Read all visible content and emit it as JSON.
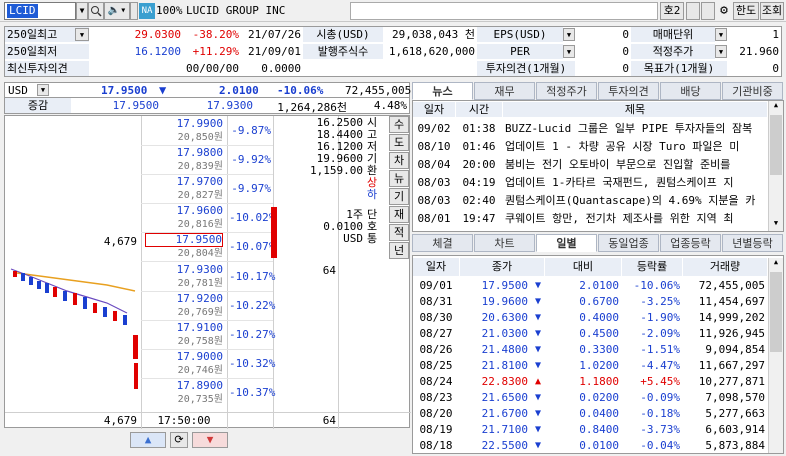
{
  "top": {
    "ticker": "LCID",
    "exchange": "NA",
    "pct": "100%",
    "name": "LUCID GROUP INC",
    "slot": "호2",
    "btn_lock": "한도",
    "btn_query": "조회"
  },
  "info_rows": [
    [
      "250일최고",
      "29.0300",
      "-38.20%",
      "21/07/26",
      "시총(USD)",
      "29,038,043 천",
      "EPS(USD)",
      "0",
      "매매단위",
      "1"
    ],
    [
      "250일최저",
      "16.1200",
      "+11.29%",
      "21/09/01",
      "발행주식수",
      "1,618,620,000",
      "PER",
      "0",
      "적정주가",
      "21.960"
    ],
    [
      "최신투자의견",
      "00/00/00",
      "0.0000",
      "",
      "",
      "",
      "투자의견(1개월)",
      "0",
      "목표가(1개월)",
      "0"
    ]
  ],
  "price": {
    "ccy": "USD",
    "last": "17.9500",
    "arrow": "▼",
    "chg": "2.0100",
    "chg_pct": "-10.06%",
    "volume": "72,455,005",
    "label": "증감",
    "bid": "17.9500",
    "ask": "17.9300",
    "vol2": "1,264,286천",
    "ratio": "4.48%"
  },
  "ladder": [
    {
      "p": "17.9900",
      "q": "20,850원",
      "pct": "-9.87%"
    },
    {
      "p": "17.9800",
      "q": "20,839원",
      "pct": "-9.92%"
    },
    {
      "p": "17.9700",
      "q": "20,827원",
      "pct": "-9.97%"
    },
    {
      "p": "17.9600",
      "q": "20,816원",
      "pct": "-10.02%"
    },
    {
      "p": "17.9500",
      "q": "20,804원",
      "pct": "-10.07%",
      "left": "4,679"
    },
    {
      "p": "17.9300",
      "q": "20,781원",
      "pct": "-10.17%",
      "right": "64"
    },
    {
      "p": "17.9200",
      "q": "20,769원",
      "pct": "-10.22%"
    },
    {
      "p": "17.9100",
      "q": "20,758원",
      "pct": "-10.27%"
    },
    {
      "p": "17.9000",
      "q": "20,746원",
      "pct": "-10.32%"
    },
    {
      "p": "17.8900",
      "q": "20,735원",
      "pct": "-10.37%"
    }
  ],
  "stats": {
    "high": "16.2500",
    "mid1": "18.4400",
    "mid2": "16.1200",
    "base": "19.9600",
    "amt": "1,159.00",
    "s1": "상",
    "s2": "하",
    "one": "1주",
    "unit": "0.0100",
    "ccy": "USD"
  },
  "side_labels": [
    "시",
    "고",
    "저",
    "기",
    "환",
    "상",
    "하",
    "단",
    "호",
    "통"
  ],
  "right_btns": [
    "수",
    "도",
    "차",
    "뉴",
    "기",
    "재",
    "적",
    "넌"
  ],
  "footer": {
    "left": "4,679",
    "time": "17:50:00",
    "right": "64"
  },
  "news_tabs": [
    "뉴스",
    "재무",
    "적정주가",
    "투자의견",
    "배당",
    "기관비중"
  ],
  "news_head": [
    "일자",
    "시간",
    "제목"
  ],
  "news": [
    [
      "09/02",
      "01:38",
      "BUZZ-Lucid 그룹은 일부 PIPE 투자자들의 잠복"
    ],
    [
      "08/10",
      "01:46",
      "업데이트 1 - 차량 공유 시장 Turo 파일은 미"
    ],
    [
      "08/04",
      "20:00",
      "붐비는 전기 오토바이 부문으로 진입할 준비를"
    ],
    [
      "08/03",
      "04:19",
      "업데이트 1-카타르 국재펀드, 퀀텀스케이프 지"
    ],
    [
      "08/03",
      "02:40",
      "퀀텀스케이프(Quantascape)의 4.69% 지분을 카"
    ],
    [
      "08/01",
      "19:47",
      "쿠웨이트 항만, 전기차 제조사를 위한 지역 최"
    ]
  ],
  "daily_tabs": [
    "체결",
    "차트",
    "일별",
    "동일업종",
    "업종등락",
    "년별등락"
  ],
  "daily_head": [
    "일자",
    "종가",
    "대비",
    "등락률",
    "거래량"
  ],
  "daily": [
    [
      "09/01",
      "17.9500",
      "down",
      "2.0100",
      "-10.06%",
      "72,455,005"
    ],
    [
      "08/31",
      "19.9600",
      "down",
      "0.6700",
      "-3.25%",
      "11,454,697"
    ],
    [
      "08/30",
      "20.6300",
      "down",
      "0.4000",
      "-1.90%",
      "14,999,202"
    ],
    [
      "08/27",
      "21.0300",
      "down",
      "0.4500",
      "-2.09%",
      "11,926,945"
    ],
    [
      "08/26",
      "21.4800",
      "down",
      "0.3300",
      "-1.51%",
      "9,094,854"
    ],
    [
      "08/25",
      "21.8100",
      "down",
      "1.0200",
      "-4.47%",
      "11,667,297"
    ],
    [
      "08/24",
      "22.8300",
      "up",
      "1.1800",
      "+5.45%",
      "10,277,871"
    ],
    [
      "08/23",
      "21.6500",
      "down",
      "0.0200",
      "-0.09%",
      "7,098,570"
    ],
    [
      "08/20",
      "21.6700",
      "down",
      "0.0400",
      "-0.18%",
      "5,277,663"
    ],
    [
      "08/19",
      "21.7100",
      "down",
      "0.8400",
      "-3.73%",
      "6,603,914"
    ],
    [
      "08/18",
      "22.5500",
      "down",
      "0.0100",
      "-0.04%",
      "5,873,884"
    ]
  ],
  "colors": {
    "up": "#e00000",
    "down": "#1a3fd0"
  }
}
